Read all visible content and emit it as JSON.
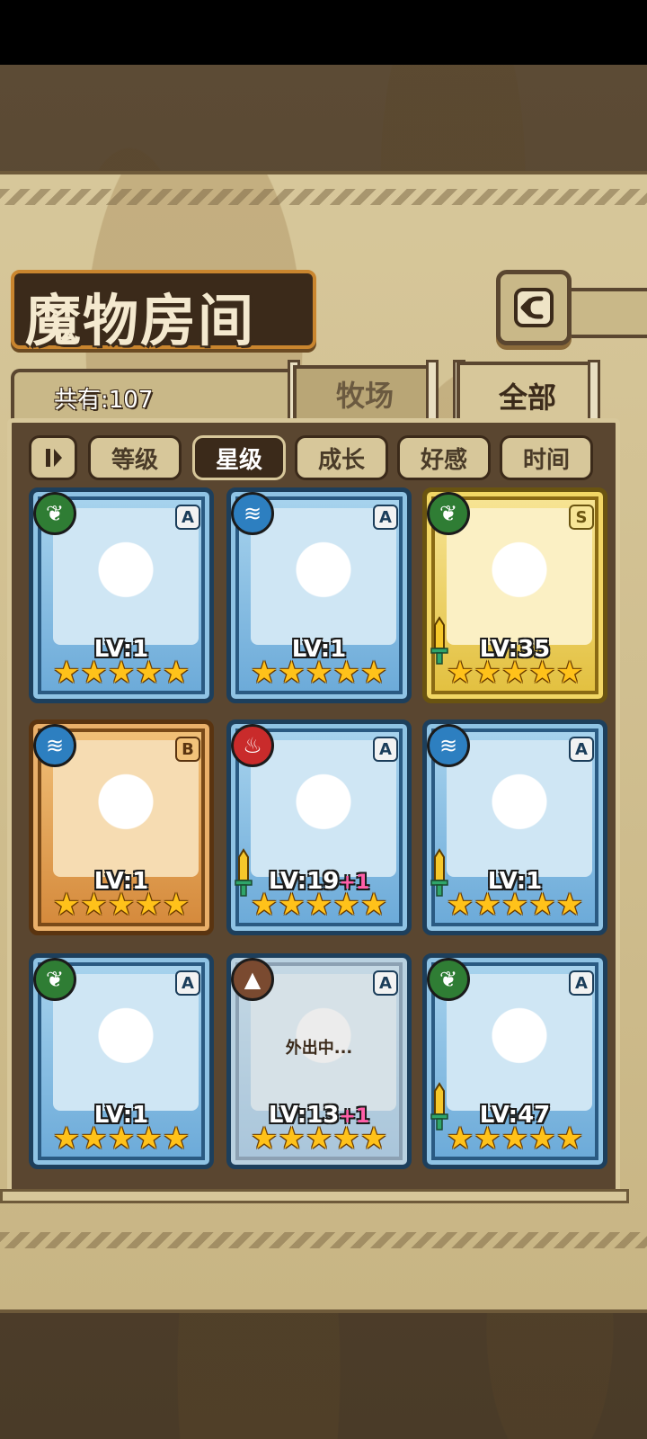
{
  "header": {
    "title": "魔物房间",
    "count_text": "共有:107"
  },
  "tabs": {
    "pasture": "牧场",
    "all": "全部"
  },
  "sort": {
    "options": [
      "等级",
      "星级",
      "成长",
      "好感",
      "时间"
    ],
    "active": "星级"
  },
  "icons": {
    "back": "back-arrow-icon",
    "sort_toggle": "sort-order-icon",
    "nature": "leaf-icon",
    "water": "water-wave-icon",
    "fire": "flame-icon",
    "earth": "mountain-icon",
    "equipped": "sword-icon"
  },
  "monsters": [
    {
      "element": "nature",
      "element_glyph": "❦",
      "rank": "A",
      "level": "LV:1",
      "bonus": "",
      "stars": "★★★★★",
      "equipped": false,
      "away": false,
      "away_text": ""
    },
    {
      "element": "water",
      "element_glyph": "≋",
      "rank": "A",
      "level": "LV:1",
      "bonus": "",
      "stars": "★★★★★",
      "equipped": false,
      "away": false,
      "away_text": ""
    },
    {
      "element": "nature",
      "element_glyph": "❦",
      "rank": "S",
      "level": "LV:35",
      "bonus": "",
      "stars": "★★★★★",
      "equipped": true,
      "away": false,
      "away_text": ""
    },
    {
      "element": "water",
      "element_glyph": "≋",
      "rank": "B",
      "level": "LV:1",
      "bonus": "",
      "stars": "★★★★★",
      "equipped": false,
      "away": false,
      "away_text": ""
    },
    {
      "element": "fire",
      "element_glyph": "♨",
      "rank": "A",
      "level": "LV:19",
      "bonus": "+1",
      "stars": "★★★★★",
      "equipped": true,
      "away": false,
      "away_text": ""
    },
    {
      "element": "water",
      "element_glyph": "≋",
      "rank": "A",
      "level": "LV:1",
      "bonus": "",
      "stars": "★★★★★",
      "equipped": true,
      "away": false,
      "away_text": ""
    },
    {
      "element": "nature",
      "element_glyph": "❦",
      "rank": "A",
      "level": "LV:1",
      "bonus": "",
      "stars": "★★★★★",
      "equipped": false,
      "away": false,
      "away_text": ""
    },
    {
      "element": "earth",
      "element_glyph": "▲",
      "rank": "A",
      "level": "LV:13",
      "bonus": "+1",
      "stars": "★★★★★",
      "equipped": false,
      "away": true,
      "away_text": "外出中..."
    },
    {
      "element": "nature",
      "element_glyph": "❦",
      "rank": "A",
      "level": "LV:47",
      "bonus": "",
      "stars": "★★★★★",
      "equipped": true,
      "away": false,
      "away_text": ""
    }
  ]
}
